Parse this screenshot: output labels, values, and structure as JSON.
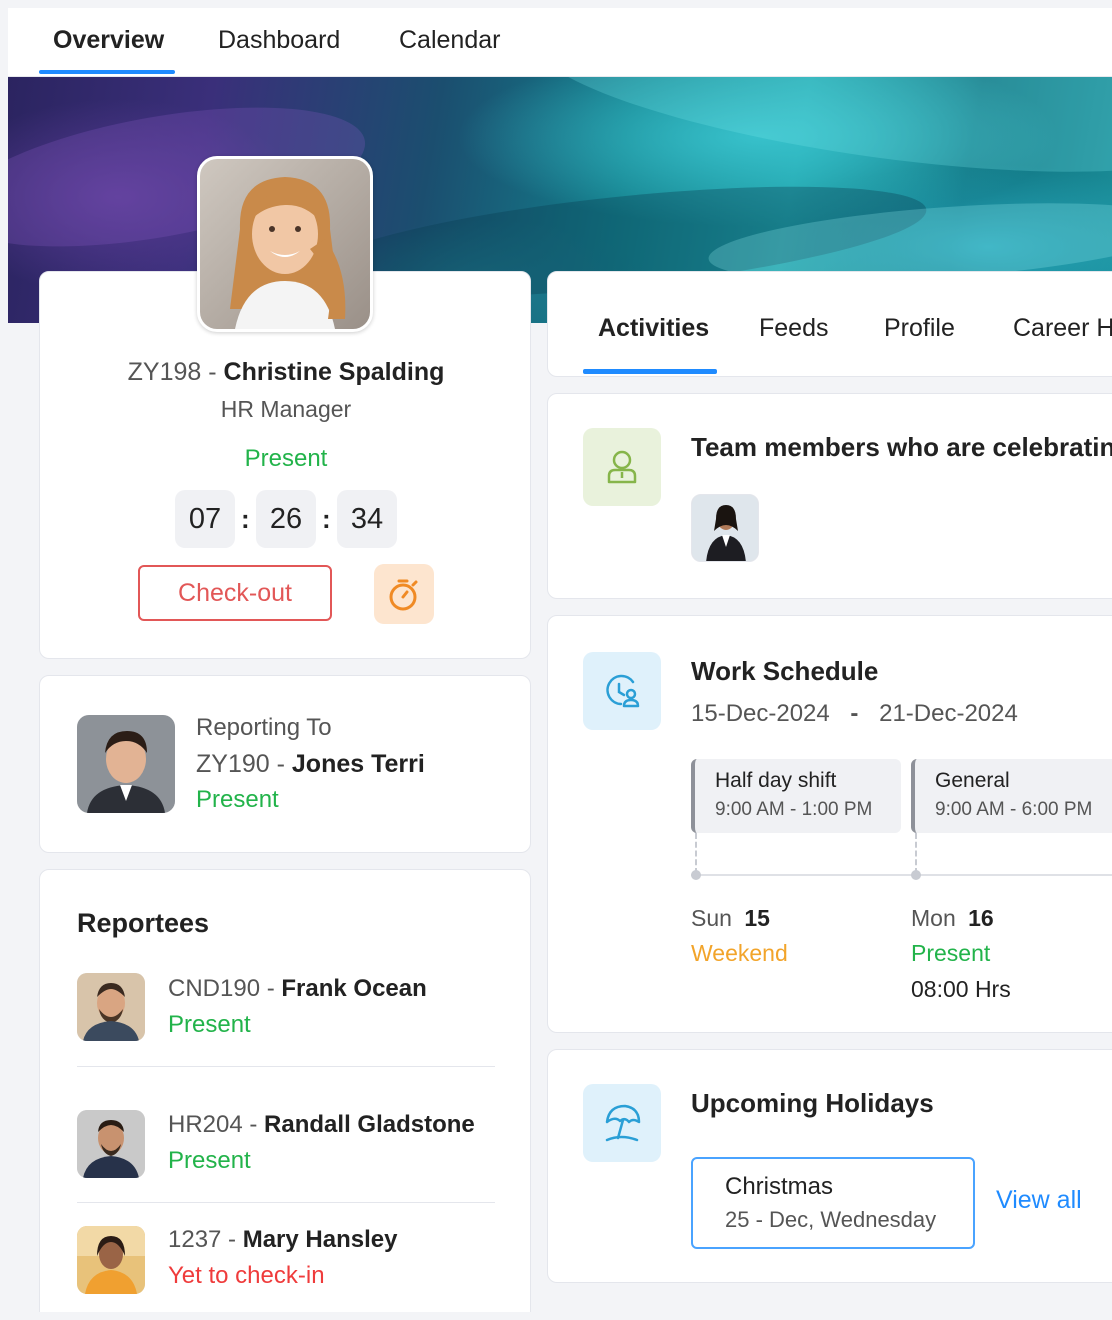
{
  "top_tabs": {
    "overview": "Overview",
    "dashboard": "Dashboard",
    "calendar": "Calendar"
  },
  "profile": {
    "id": "ZY198",
    "sep": " - ",
    "name": "Christine Spalding",
    "role": "HR Manager",
    "status": "Present",
    "timer": {
      "hh": "07",
      "mm": "26",
      "ss": "34",
      "colon": ":"
    },
    "checkout_label": "Check-out"
  },
  "reporting": {
    "label": "Reporting To",
    "id": "ZY190",
    "sep": " - ",
    "name": "Jones Terri",
    "status": "Present"
  },
  "reportees": {
    "title": "Reportees",
    "items": [
      {
        "id": "CND190",
        "sep": " - ",
        "name": "Frank Ocean",
        "status": "Present"
      },
      {
        "id": "HR204",
        "sep": " - ",
        "name": "Randall Gladstone",
        "status": "Present"
      },
      {
        "id": "1237",
        "sep": " - ",
        "name": "Mary Hansley",
        "status": "Yet to check-in"
      }
    ]
  },
  "content_tabs": {
    "activities": "Activities",
    "feeds": "Feeds",
    "profile": "Profile",
    "career": "Career H"
  },
  "celebrations": {
    "title": "Team members who are celebratin"
  },
  "schedule": {
    "title": "Work Schedule",
    "range_start": "15-Dec-2024",
    "range_sep": "-",
    "range_end": "21-Dec-2024",
    "shifts": [
      {
        "name": "Half day shift",
        "time": "9:00 AM - 1:00 PM"
      },
      {
        "name": "General",
        "time": "9:00 AM - 6:00 PM"
      }
    ],
    "days": [
      {
        "dow": "Sun",
        "date": "15",
        "status": "Weekend",
        "hours": ""
      },
      {
        "dow": "Mon",
        "date": "16",
        "status": "Present",
        "hours": "08:00 Hrs"
      }
    ]
  },
  "holidays": {
    "title": "Upcoming Holidays",
    "items": [
      {
        "name": "Christmas",
        "date": "25 - Dec, Wednesday"
      }
    ],
    "view_all": "View all"
  },
  "colors": {
    "accent": "#1f8bff",
    "present": "#22b34a",
    "late": "#ef3b3b",
    "weekend": "#f2a42a",
    "checkout": "#e25757"
  }
}
